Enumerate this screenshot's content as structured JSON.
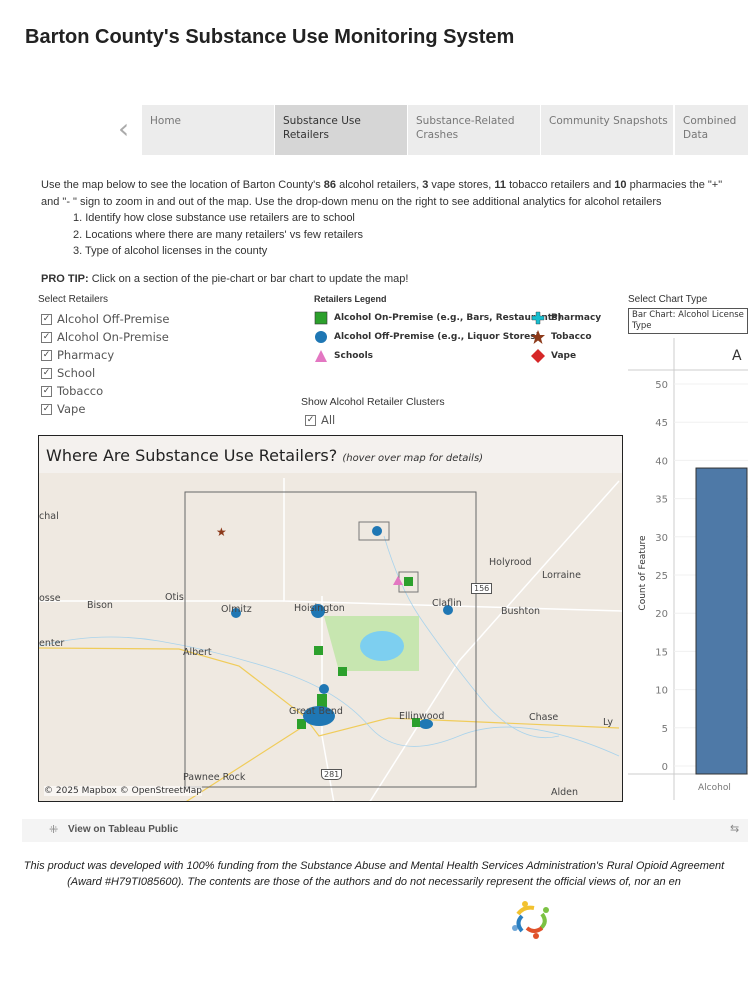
{
  "title": "Barton County's Substance Use Monitoring System",
  "tabs": [
    {
      "label": "Home"
    },
    {
      "label": "Substance Use\nRetailers"
    },
    {
      "label": "Substance-Related\nCrashes"
    },
    {
      "label": "Community Snapshots"
    },
    {
      "label": "Combined Data"
    }
  ],
  "intro": {
    "line1_a": "Use the map below to see the location of Barton County's ",
    "n_alcohol": "86",
    "line1_b": " alcohol retailers, ",
    "n_vape": "3",
    "line1_c": " vape stores,  ",
    "n_tobacco": "11",
    "line1_d": " tobacco retailers and  ",
    "n_pharm": "10",
    "line1_e": " pharmacies",
    "line2": "the \"+\" and \"- \" sign to zoom in and out of the map. Use the drop-down menu on the right to see additional analytics for alcohol retailers",
    "items": [
      "1. Identify how close substance use retailers are to school",
      "2. Locations where there are many retailers' vs few retailers",
      "3. Type of alcohol licenses in the county"
    ],
    "protip_label": "PRO TIP:",
    "protip": " Click on a section of the pie-chart or bar chart to update the map!"
  },
  "filters": {
    "label": "Select Retailers",
    "items": [
      {
        "label": "Alcohol Off-Premise",
        "checked": true
      },
      {
        "label": "Alcohol On-Premise",
        "checked": true
      },
      {
        "label": "Pharmacy",
        "checked": true
      },
      {
        "label": "School",
        "checked": true
      },
      {
        "label": "Tobacco",
        "checked": true
      },
      {
        "label": "Vape",
        "checked": true
      }
    ]
  },
  "legend": {
    "title": "Retailers Legend",
    "items": [
      {
        "label": "Alcohol On-Premise (e.g., Bars, Restaurants)",
        "icon": "green-square",
        "color": "#2ca02c"
      },
      {
        "label": "Alcohol Off-Premise (e.g., Liquor Stores)",
        "icon": "blue-circle",
        "color": "#1f77b4"
      },
      {
        "label": "Schools",
        "icon": "pink-triangle",
        "color": "#e377c2"
      },
      {
        "label": "Pharmacy",
        "icon": "teal-cross",
        "color": "#17becf"
      },
      {
        "label": "Tobacco",
        "icon": "brown-star",
        "color": "#8c3a1a"
      },
      {
        "label": "Vape",
        "icon": "red-diamond",
        "color": "#d62728"
      }
    ]
  },
  "clusters": {
    "label": "Show Alcohol Retailer Clusters",
    "option": "All",
    "checked": true
  },
  "chart_type": {
    "label": "Select Chart Type",
    "value": "Bar Chart: Alcohol License Type"
  },
  "map": {
    "title": "Where Are Substance Use Retailers?",
    "subtitle": "(hover over map for details)",
    "attribution": "© 2025 Mapbox  © OpenStreetMap",
    "towns": [
      "Holyrood",
      "Lorraine",
      "Bison",
      "Otis",
      "Olmitz",
      "Hoisington",
      "Claflin",
      "Bushton",
      "Albert",
      "Great Bend",
      "Ellinwood",
      "Chase",
      "Pawnee Rock",
      "Alden",
      "Ly",
      "osse",
      "enter",
      "chal"
    ],
    "shields": [
      "156",
      "281"
    ]
  },
  "chart_data": {
    "type": "bar",
    "title": "A",
    "ylabel": "Count of Feature",
    "categories": [
      "Alcohol"
    ],
    "values": [
      39
    ],
    "ylim": [
      0,
      50
    ],
    "yticks": [
      0,
      5,
      10,
      15,
      20,
      25,
      30,
      35,
      40,
      45,
      50
    ],
    "bar_color": "#4e79a7",
    "grid": true
  },
  "toolbar": {
    "view_label": "View on Tableau Public"
  },
  "footer": {
    "line1": "This product was developed with 100% funding from the Substance Abuse and Mental Health Services Administration's Rural Opioid",
    "line2": "Agreement (Award #H79TI085600). The contents are those of the authors and do not necessarily represent the official views of, nor an en"
  }
}
